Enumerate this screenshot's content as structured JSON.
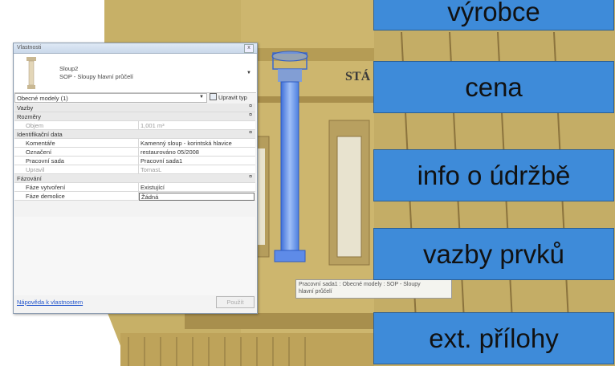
{
  "dialog": {
    "title": "Vlastnosti",
    "close_glyph": "x",
    "type_name": "Sloup2",
    "type_family": "SOP - Sloupy hlavní průčelí",
    "selector_value": "Obecné modely (1)",
    "edit_type_label": "Upravit typ",
    "rows": [
      {
        "kind": "cat",
        "label": "Vazby",
        "value": "",
        "toggle": "¤"
      },
      {
        "kind": "cat",
        "label": "Rozměry",
        "value": "",
        "toggle": "¤"
      },
      {
        "kind": "prop",
        "label": "Objem",
        "value": "1,001 m³",
        "dim": true
      },
      {
        "kind": "cat",
        "label": "Identifikační data",
        "value": "",
        "toggle": "¤"
      },
      {
        "kind": "prop",
        "label": "Komentáře",
        "value": "Kamenný sloup - korintská hlavice"
      },
      {
        "kind": "prop",
        "label": "Označení",
        "value": "restaurováno 05/2008"
      },
      {
        "kind": "prop",
        "label": "Pracovní sada",
        "value": "Pracovní sada1"
      },
      {
        "kind": "prop",
        "label": "Upravil",
        "value": "TomasL",
        "dim": true
      },
      {
        "kind": "cat",
        "label": "Fázování",
        "value": "",
        "toggle": "¤"
      },
      {
        "kind": "prop",
        "label": "Fáze vytvoření",
        "value": "Existující"
      },
      {
        "kind": "prop",
        "label": "Fáze demolice",
        "value": "Žádná",
        "editing": true
      }
    ],
    "help_link": "Nápověda k vlastnostem",
    "apply_label": "Použít"
  },
  "tooltip": {
    "line1": "Pracovní sada1 : Obecné modely : SOP - Sloupy",
    "line2": "hlavní průčelí"
  },
  "scene": {
    "facade_text": "STÁ"
  },
  "callouts": [
    {
      "label": "výrobce"
    },
    {
      "label": "cena"
    },
    {
      "label": "info o údržbě"
    },
    {
      "label": "vazby prvků"
    },
    {
      "label": "ext. přílohy"
    }
  ],
  "colors": {
    "callout_fill": "#3e8bd9",
    "facade": "#c9b26a",
    "column_highlight": "#5b8fe8"
  }
}
